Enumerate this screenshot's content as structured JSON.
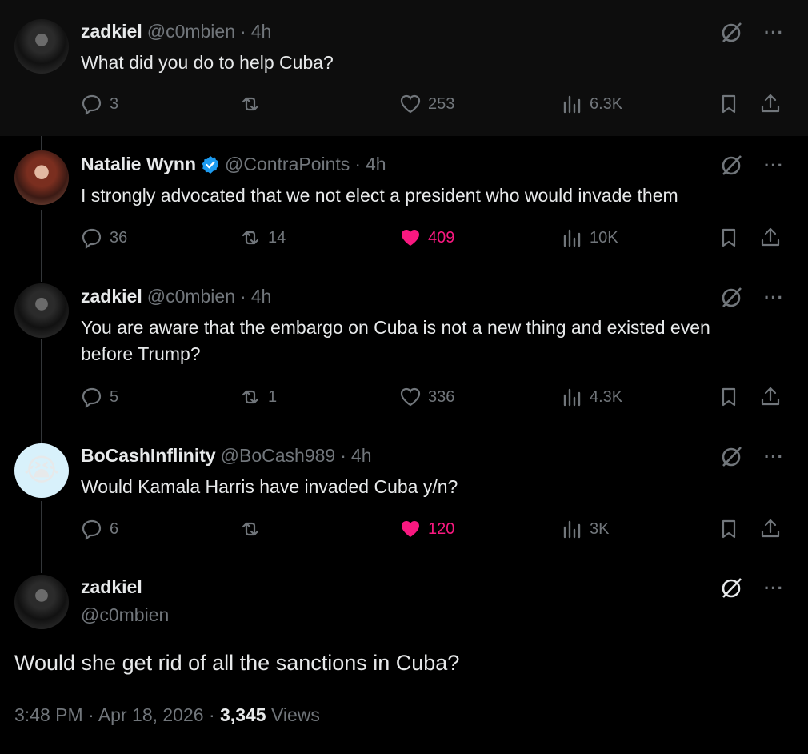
{
  "replies": [
    {
      "name": "zadkiel",
      "handle": "@c0mbien",
      "time": "4h",
      "text": "What did you do to help Cuba?",
      "verified": false,
      "stats": {
        "replies": "3",
        "retweets": "",
        "likes": "253",
        "views": "6.3K"
      },
      "liked": false
    },
    {
      "name": "Natalie Wynn",
      "handle": "@ContraPoints",
      "time": "4h",
      "text": "I strongly advocated that we not elect a president who would invade them",
      "verified": true,
      "stats": {
        "replies": "36",
        "retweets": "14",
        "likes": "409",
        "views": "10K"
      },
      "liked": true
    },
    {
      "name": "zadkiel",
      "handle": "@c0mbien",
      "time": "4h",
      "text": "You are aware that the embargo on Cuba is not a new thing and existed even before Trump?",
      "verified": false,
      "stats": {
        "replies": "5",
        "retweets": "1",
        "likes": "336",
        "views": "4.3K"
      },
      "liked": false
    },
    {
      "name": "BoCashInflinity",
      "handle": "@BoCash989",
      "time": "4h",
      "text": "Would Kamala Harris have invaded Cuba y/n?",
      "verified": false,
      "avatar_emoji": "😭",
      "stats": {
        "replies": "6",
        "retweets": "",
        "likes": "120",
        "views": "3K"
      },
      "liked": true
    }
  ],
  "separator": "·",
  "main": {
    "name": "zadkiel",
    "handle": "@c0mbien",
    "text": "Would she get rid of all the sanctions in Cuba?",
    "time": "3:48 PM",
    "date": "Apr 18, 2026",
    "views_count": "3,345",
    "views_label": "Views"
  },
  "colors": {
    "background": "#000000",
    "text": "#e7e9ea",
    "muted": "#71767b",
    "like": "#f91880",
    "verified": "#1d9bf0"
  },
  "icons": [
    "reply-icon",
    "retweet-icon",
    "like-icon",
    "views-icon",
    "bookmark-icon",
    "share-icon",
    "grok-icon",
    "more-icon",
    "verified-badge-icon"
  ]
}
